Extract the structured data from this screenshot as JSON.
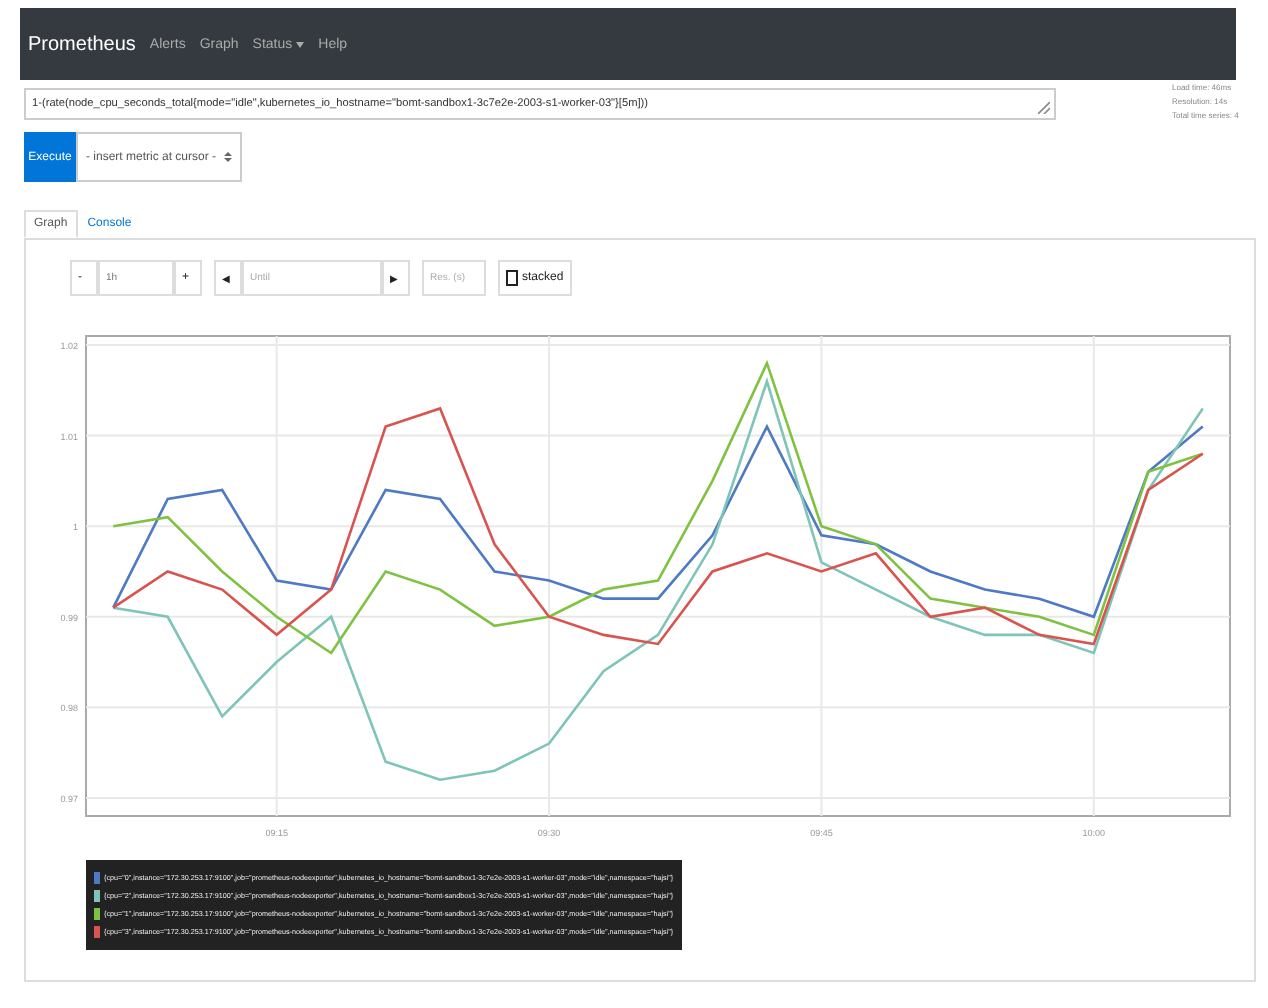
{
  "navbar": {
    "brand": "Prometheus",
    "links": [
      {
        "label": "Alerts",
        "dropdown": false
      },
      {
        "label": "Graph",
        "dropdown": false
      },
      {
        "label": "Status",
        "dropdown": true
      },
      {
        "label": "Help",
        "dropdown": false
      }
    ]
  },
  "query": {
    "value": "1-(rate(node_cpu_seconds_total{mode=\"idle\",kubernetes_io_hostname=\"bomt-sandbox1-3c7e2e-2003-s1-worker-03\"}[5m]))"
  },
  "stats": [
    "Load time: 46ms",
    "Resolution: 14s",
    "Total time series: 4"
  ],
  "execute_button": "Execute",
  "metric_select": "- insert metric at cursor -",
  "tabs": [
    {
      "label": "Graph",
      "selected": true
    },
    {
      "label": "Console",
      "selected": false
    }
  ],
  "controls": {
    "minus": "-",
    "range": "1h",
    "plus": "+",
    "back": "◀",
    "until_placeholder": "Until",
    "forward": "▶",
    "resolution_placeholder": "Res. (s)",
    "stacked": {
      "label": "stacked",
      "checked": false
    }
  },
  "chart_data": {
    "type": "line",
    "grid": true,
    "categories": [
      null,
      null,
      null,
      "09:15",
      null,
      null,
      null,
      null,
      "09:30",
      null,
      null,
      null,
      null,
      "09:45",
      null,
      null,
      null,
      null,
      "10:00",
      null,
      null
    ],
    "ylim": [
      0.968,
      1.021
    ],
    "yticks": [
      {
        "value": 0.97,
        "label": "0.97"
      },
      {
        "value": 0.98,
        "label": "0.98"
      },
      {
        "value": 0.99,
        "label": "0.99"
      },
      {
        "value": 1,
        "label": "1"
      },
      {
        "value": 1.01,
        "label": "1.01"
      },
      {
        "value": 1.02,
        "label": "1.02"
      }
    ],
    "series": [
      {
        "name": "{cpu=\"0\",instance=\"172.30.253.17:9100\",job=\"prometheus-nodeexporter\",kubernetes_io_hostname=\"bomt-sandbox1-3c7e2e-2003-s1-worker-03\",mode=\"idle\",namespace=\"hajsi\"}",
        "color": "#4e79c4",
        "values": [
          0.991,
          1.003,
          1.004,
          0.994,
          0.993,
          1.004,
          1.003,
          0.995,
          0.994,
          0.992,
          0.992,
          0.999,
          1.011,
          0.999,
          0.998,
          0.995,
          0.993,
          0.992,
          0.99,
          1.006,
          1.011
        ]
      },
      {
        "name": "{cpu=\"2\",instance=\"172.30.253.17:9100\",job=\"prometheus-nodeexporter\",kubernetes_io_hostname=\"bomt-sandbox1-3c7e2e-2003-s1-worker-03\",mode=\"idle\",namespace=\"hajsi\"}",
        "color": "#7ec4b8",
        "values": [
          0.991,
          0.99,
          0.979,
          0.985,
          0.99,
          0.974,
          0.972,
          0.973,
          0.976,
          0.984,
          0.988,
          0.998,
          1.016,
          0.996,
          0.993,
          0.99,
          0.988,
          0.988,
          0.986,
          1.004,
          1.013
        ]
      },
      {
        "name": "{cpu=\"1\",instance=\"172.30.253.17:9100\",job=\"prometheus-nodeexporter\",kubernetes_io_hostname=\"bomt-sandbox1-3c7e2e-2003-s1-worker-03\",mode=\"idle\",namespace=\"hajsi\"}",
        "color": "#7fc241",
        "values": [
          1.0,
          1.001,
          0.995,
          0.99,
          0.986,
          0.995,
          0.993,
          0.989,
          0.99,
          0.993,
          0.994,
          1.005,
          1.018,
          1.0,
          0.998,
          0.992,
          0.991,
          0.99,
          0.988,
          1.006,
          1.008
        ]
      },
      {
        "name": "{cpu=\"3\",instance=\"172.30.253.17:9100\",job=\"prometheus-nodeexporter\",kubernetes_io_hostname=\"bomt-sandbox1-3c7e2e-2003-s1-worker-03\",mode=\"idle\",namespace=\"hajsi\"}",
        "color": "#d9534f",
        "values": [
          0.991,
          0.995,
          0.993,
          0.988,
          0.993,
          1.011,
          1.013,
          0.998,
          0.99,
          0.988,
          0.987,
          0.995,
          0.997,
          0.995,
          0.997,
          0.99,
          0.991,
          0.988,
          0.987,
          1.004,
          1.008
        ]
      }
    ]
  }
}
